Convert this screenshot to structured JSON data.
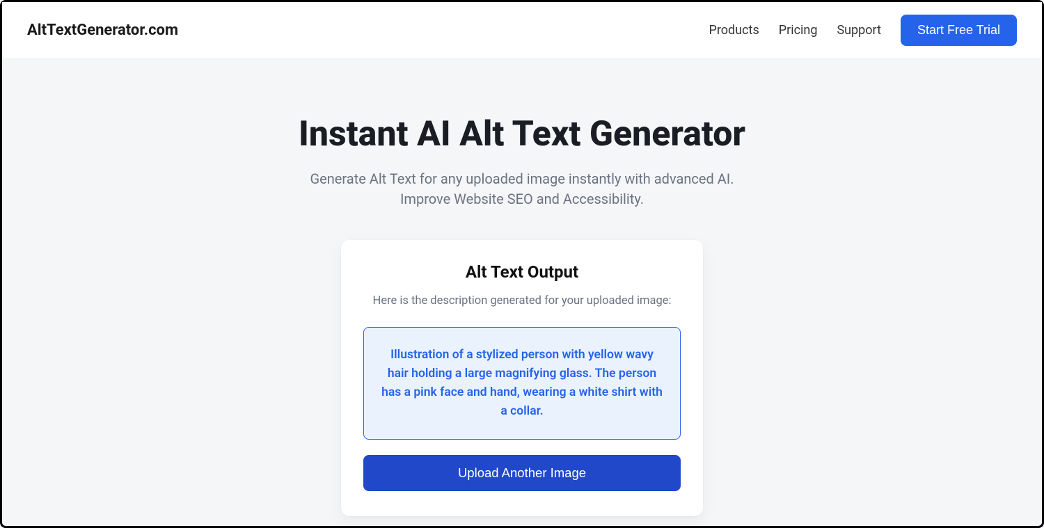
{
  "header": {
    "logo": "AltTextGenerator.com",
    "nav": {
      "products": "Products",
      "pricing": "Pricing",
      "support": "Support"
    },
    "cta": "Start Free Trial"
  },
  "hero": {
    "title": "Instant AI Alt Text Generator",
    "subtitle": "Generate Alt Text for any uploaded image instantly with advanced AI. Improve Website SEO and Accessibility."
  },
  "card": {
    "title": "Alt Text Output",
    "subtitle": "Here is the description generated for your uploaded image:",
    "output": "Illustration of a stylized person with yellow wavy hair holding a large magnifying glass. The person has a pink face and hand, wearing a white shirt with a collar.",
    "button": "Upload Another Image"
  }
}
